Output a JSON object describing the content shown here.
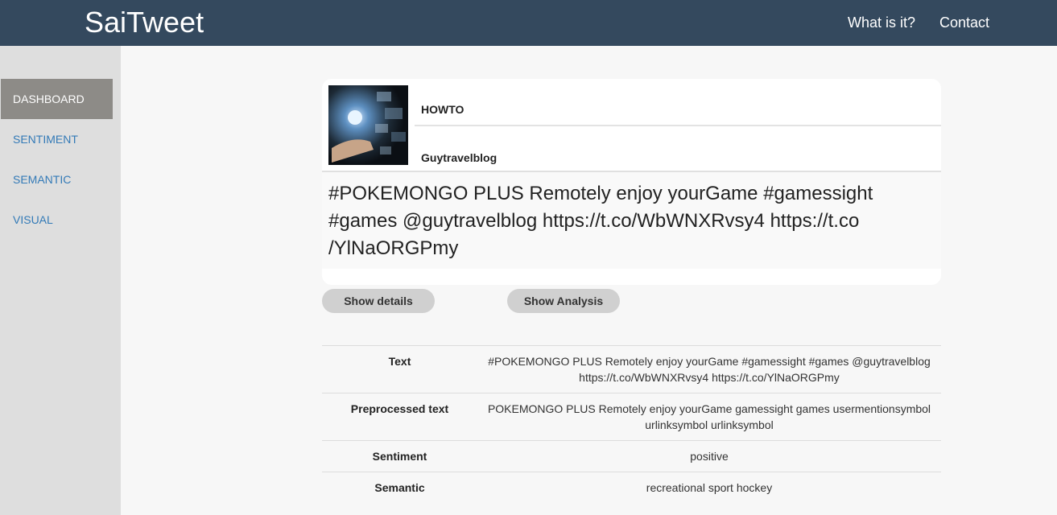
{
  "header": {
    "brand": "SaiTweet",
    "nav": [
      "What is it?",
      "Contact"
    ]
  },
  "sidebar": {
    "items": [
      "DASHBOARD",
      "SENTIMENT",
      "SEMANTIC",
      "VISUAL"
    ],
    "active": "DASHBOARD"
  },
  "tweet": {
    "title": "HOWTO",
    "user": "Guytravelblog",
    "text_lines": [
      "#POKEMONGO PLUS Remotely enjoy yourGame #gamessight",
      "#games @guytravelblog https://t.co/WbWNXRvsy4 https://t.co",
      "/YlNaORGPmy"
    ]
  },
  "buttons": {
    "details": "Show details",
    "analysis": "Show Analysis"
  },
  "details": {
    "rows": [
      {
        "label": "Text",
        "value_lines": [
          "#POKEMONGO PLUS Remotely enjoy yourGame #gamessight #games @guytravelblog",
          "https://t.co/WbWNXRvsy4 https://t.co/YlNaORGPmy"
        ]
      },
      {
        "label": "Preprocessed text",
        "value_lines": [
          "POKEMONGO PLUS Remotely enjoy yourGame gamessight games usermentionsymbol",
          "urlinksymbol urlinksymbol"
        ]
      },
      {
        "label": "Sentiment",
        "value_lines": [
          "positive"
        ]
      },
      {
        "label": "Semantic",
        "value_lines": [
          "recreational sport hockey"
        ]
      }
    ]
  },
  "colors": {
    "header_bg": "#34495e",
    "sidebar_bg": "#dedede",
    "active_item_bg": "#8d8b87",
    "link": "#337ab7",
    "button_bg": "#d0d0d0"
  }
}
